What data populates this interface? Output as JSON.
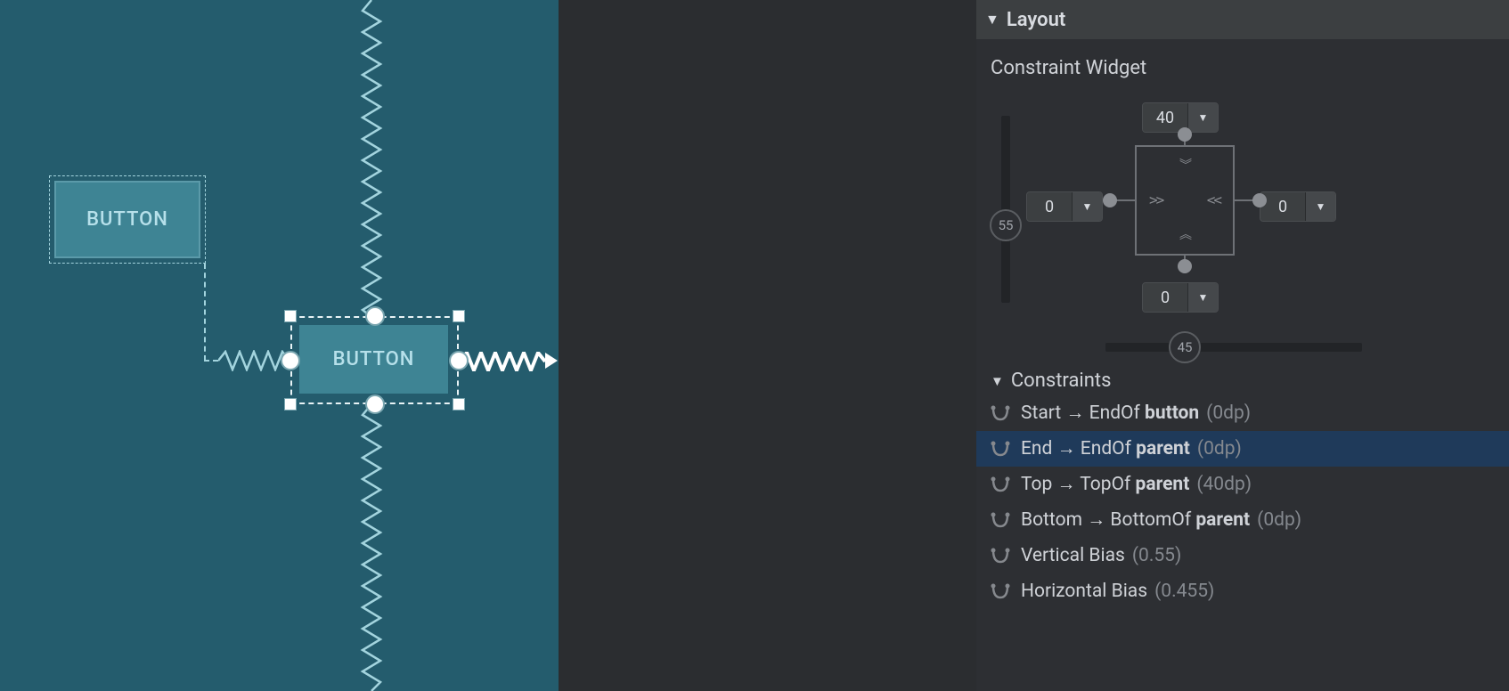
{
  "canvas": {
    "button1_label": "BUTTON",
    "button2_label": "BUTTON"
  },
  "layout_panel": {
    "title": "Layout",
    "widget_title": "Constraint Widget",
    "bias_vertical": "55",
    "bias_horizontal": "45",
    "margins": {
      "top": "40",
      "left": "0",
      "right": "0",
      "bottom": "0"
    },
    "constraints_title": "Constraints",
    "constraints": [
      {
        "source": "Start",
        "rel": "EndOf",
        "target": "button",
        "value": "(0dp)",
        "selected": false
      },
      {
        "source": "End",
        "rel": "EndOf",
        "target": "parent",
        "value": "(0dp)",
        "selected": true
      },
      {
        "source": "Top",
        "rel": "TopOf",
        "target": "parent",
        "value": "(40dp)",
        "selected": false
      },
      {
        "source": "Bottom",
        "rel": "BottomOf",
        "target": "parent",
        "value": "(0dp)",
        "selected": false
      }
    ],
    "vbias_row": {
      "label": "Vertical Bias",
      "value": "(0.55)"
    },
    "hbias_row": {
      "label": "Horizontal Bias",
      "value": "(0.455)"
    }
  }
}
